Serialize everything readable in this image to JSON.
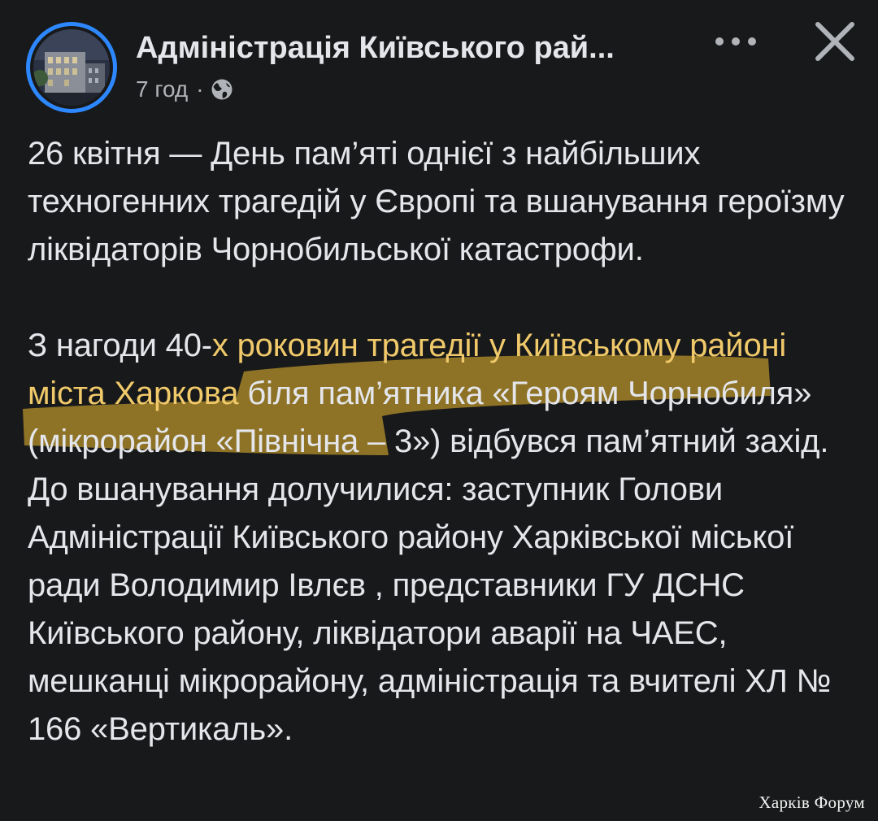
{
  "post": {
    "page_name": "Адміністрація Київського рай...",
    "time": "7 год",
    "separator": "·",
    "audience_icon": "globe-icon",
    "more_icon": "more-dots-icon",
    "close_icon": "close-icon",
    "paragraph1": "26 квітня — День пам’яті однієї з найбільших техногенних трагедій у Європі та вшанування героїзму ліквідаторів Чорнобильської катастрофи.",
    "paragraph2_before": "З нагоди 40-",
    "paragraph2_highlight": "х роковин трагедії у Київському районі міста Харкова",
    "paragraph2_after": " біля пам’ятника «Героям Чорнобиля» (мікрорайон «Північна – 3») відбувся пам’ятний захід. До вшанування долучилися: заступник Голови Адміністрації Київського району Харківської міської ради Володимир Івлєв , представники ГУ ДСНС Київського району, ліквідатори аварії на ЧАЕС, мешканці мікрорайону, адміністрація та вчителі ХЛ № 166 «Вертикаль».",
    "highlight_color": "#c9a23a"
  },
  "watermark": "Харків Форум",
  "colors": {
    "background": "#18191a",
    "text": "#e4e6eb",
    "secondary_text": "#b0b3b8",
    "avatar_ring": "#2d88ff"
  }
}
